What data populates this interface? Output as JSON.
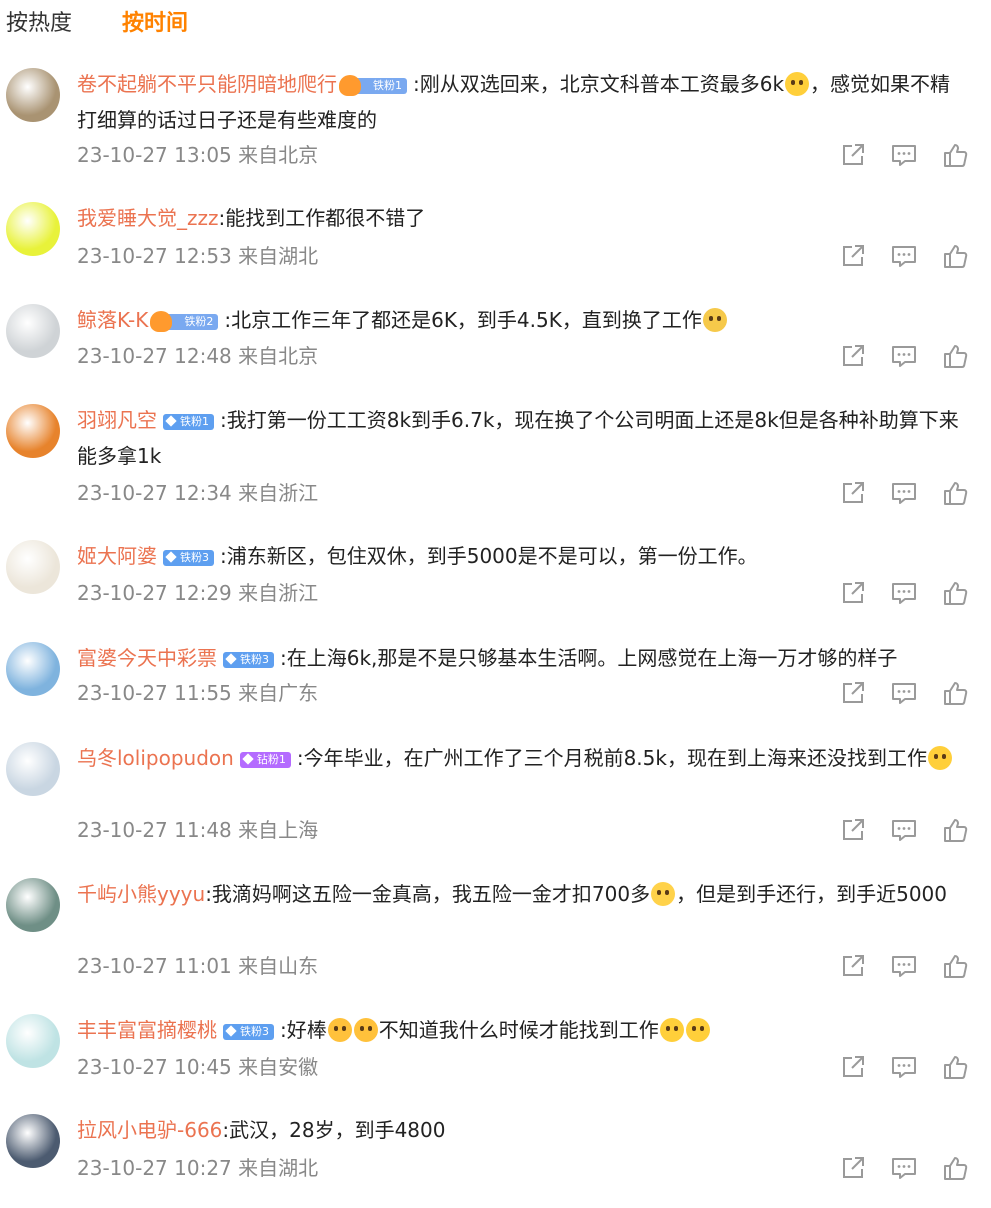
{
  "tabs": [
    {
      "label": "按热度",
      "active": false
    },
    {
      "label": "按时间",
      "active": true
    }
  ],
  "colors": {
    "accent": "#ff8200",
    "username": "#eb7350",
    "meta": "#888888",
    "icon": "#9a9a9a"
  },
  "comments": [
    {
      "user": "卷不起躺不平只能阴暗地爬行",
      "badge": "铁粉1",
      "badge_type": "crown",
      "text_a": ":刚从双选回来，北京文科普本工资最多6k",
      "emoji": [
        "crying"
      ],
      "text_b": "，感觉如果不精打细算的话过日子还是有些难度的",
      "meta": "23-10-27 13:05 来自北京",
      "avatar_color": "#a99372"
    },
    {
      "user": "我爱睡大觉_zzz",
      "badge": "",
      "badge_type": "",
      "text_a": ":能找到工作都很不错了",
      "emoji": [],
      "text_b": "",
      "meta": "23-10-27 12:53 来自湖北",
      "avatar_color": "#e8f23a"
    },
    {
      "user": "鲸落K-K",
      "badge": "铁粉2",
      "badge_type": "crown",
      "text_a": ":北京工作三年了都还是6K，到手4.5K，直到换了工作",
      "emoji": [
        "sad"
      ],
      "text_b": "",
      "meta": "23-10-27 12:48 来自北京",
      "avatar_color": "#cfd3d6"
    },
    {
      "user": "羽翊凡空",
      "badge": "铁粉1",
      "badge_type": "iron",
      "text_a": ":我打第一份工工资8k到手6.7k，现在换了个公司明面上还是8k但是各种补助算下来能多拿1k",
      "emoji": [],
      "text_b": "",
      "meta": "23-10-27 12:34 来自浙江",
      "avatar_color": "#e7832c"
    },
    {
      "user": "姬大阿婆",
      "badge": "铁粉3",
      "badge_type": "iron",
      "text_a": ":浦东新区，包住双休，到手5000是不是可以，第一份工作。",
      "emoji": [],
      "text_b": "",
      "meta": "23-10-27 12:29 来自浙江",
      "avatar_color": "#ece6da"
    },
    {
      "user": "富婆今天中彩票",
      "badge": "铁粉3",
      "badge_type": "iron",
      "text_a": ":在上海6k,那是不是只够基本生活啊。上网感觉在上海一万才够的样子",
      "emoji": [],
      "text_b": "",
      "meta": "23-10-27 11:55 来自广东",
      "avatar_color": "#7fb3de"
    },
    {
      "user": "乌冬lolipopudon",
      "badge": "钻粉1",
      "badge_type": "diamond",
      "text_a": ":今年毕业，在广州工作了三个月税前8.5k，现在到上海来还没找到工作",
      "emoji": [
        "crying"
      ],
      "text_b": "",
      "meta": "23-10-27 11:48 来自上海",
      "avatar_color": "#c9d6e2"
    },
    {
      "user": "千屿小熊yyyu",
      "badge": "",
      "badge_type": "",
      "text_a": ":我滴妈啊这五险一金真高，我五险一金才扣700多",
      "emoji": [
        "laugh-cry"
      ],
      "text_b": "，但是到手还行，到手近5000",
      "meta": "23-10-27 11:01 来自山东",
      "avatar_color": "#6f8f86"
    },
    {
      "user": "丰丰富富摘樱桃",
      "badge": "铁粉3",
      "badge_type": "iron",
      "text_a": ":好棒",
      "emoji": [
        "starstruck",
        "starstruck"
      ],
      "text_b": "不知道我什么时候才能找到工作",
      "emoji_b": [
        "crying",
        "crying"
      ],
      "meta": "23-10-27 10:45 来自安徽",
      "avatar_color": "#bfe3e4"
    },
    {
      "user": "拉风小电驴-666",
      "badge": "",
      "badge_type": "",
      "text_a": ":武汉，28岁，到手4800",
      "emoji": [],
      "text_b": "",
      "meta": "23-10-27 10:27 来自湖北",
      "avatar_color": "#4c5b70"
    }
  ]
}
